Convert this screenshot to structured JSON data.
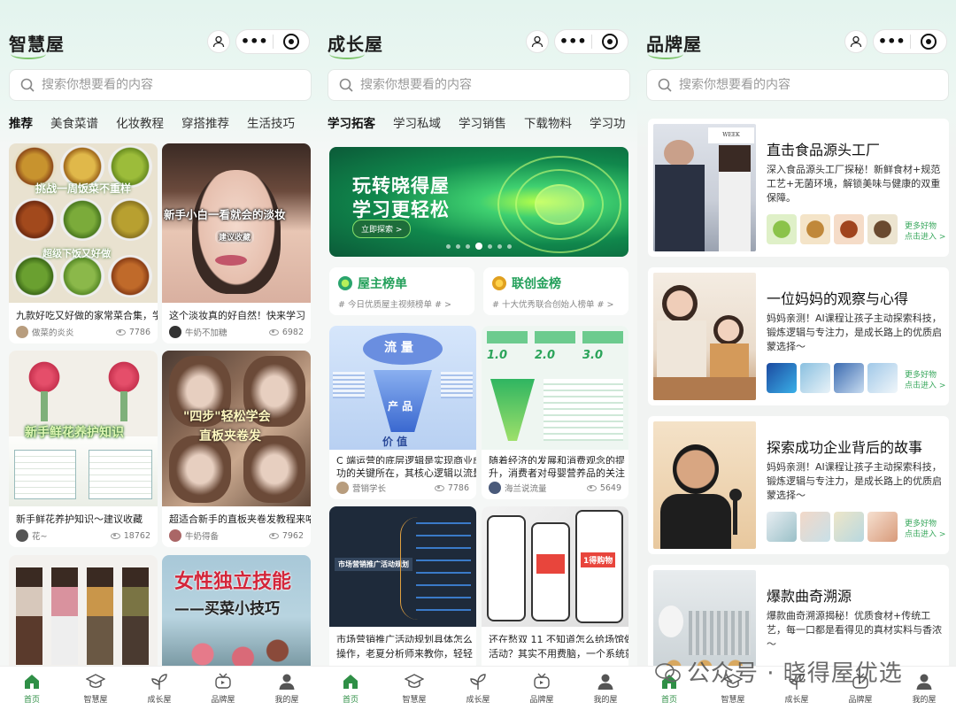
{
  "screens": [
    {
      "title": "智慧屋",
      "search_placeholder": "搜索你想要看的内容",
      "tabs": [
        "推荐",
        "美食菜谱",
        "化妆教程",
        "穿搭推荐",
        "生活技巧"
      ],
      "cards": [
        {
          "title": "九款好吃又好做的家常菜合集，学",
          "author": "做菜的炎炎",
          "views": "7786",
          "overlay": "挑战一周饭菜不重样",
          "overlay2": "超级下饭又好做"
        },
        {
          "title": "这个淡妆真的好自然！快来学习",
          "author": "牛奶不加糖",
          "views": "6982",
          "overlay": "新手小白一看就会的淡妆",
          "overlay2": "建议收藏"
        },
        {
          "title": "新手鲜花养护知识～建议收藏",
          "author": "花~",
          "views": "18762",
          "overlay": "新手鲜花养护知识"
        },
        {
          "title": "超适合新手的直板夹卷发教程来咯",
          "author": "牛奶得备",
          "views": "7962",
          "overlay": "\"四步\"轻松学会",
          "overlay2": "直板夹卷发"
        },
        {
          "title": "",
          "author": "",
          "views": ""
        },
        {
          "title": "",
          "author": "",
          "views": "",
          "overlay": "女性独立技能",
          "overlay2": "——买菜小技巧"
        }
      ]
    },
    {
      "title": "成长屋",
      "search_placeholder": "搜索你想要看的内容",
      "tabs": [
        "学习拓客",
        "学习私域",
        "学习销售",
        "下载物料",
        "学习功"
      ],
      "banner": {
        "line1": "玩转晓得屋",
        "line2": "学习更轻松",
        "button": "立即探索 >"
      },
      "ranks": [
        {
          "title": "屋主榜单",
          "sub": "# 今日优质屋主视频榜单 #    >"
        },
        {
          "title": "联创金榜",
          "sub": "# 十大优秀联合创始人榜单 #    >"
        }
      ],
      "cards": [
        {
          "title": "C 端运营的底层逻辑是实现商业成",
          "title2": "功的关键所在，其核心逻辑以流量",
          "author": "营销学长",
          "views": "7786",
          "overlay": "流 量",
          "overlay2": "产 品",
          "overlay3": "价 值"
        },
        {
          "title": "随着经济的发展和消费观念的提",
          "title2": "升，消费者对母婴营养品的关注",
          "author": "海兰说流量",
          "views": "5649",
          "steps": [
            "1.0",
            "2.0",
            "3.0"
          ]
        },
        {
          "title": "市场营销推广活动规划具体怎么",
          "title2": "操作，老夏分析师来教你，轻轻",
          "author": "",
          "views": "",
          "overlay": "市场营销推广活动规划"
        },
        {
          "title": "还在愁双 11 不知道怎么给场馆做",
          "title2": "活动？其实不用费脑，一个系统就",
          "author": "",
          "views": "",
          "overlay": "1得购物"
        }
      ]
    },
    {
      "title": "品牌屋",
      "search_placeholder": "搜索你想要看的内容",
      "brands": [
        {
          "title": "直击食品源头工厂",
          "desc": "深入食品源头工厂探秘！新鲜食材+规范工艺+无菌环境，解锁美味与健康的双重保障。",
          "more": "更多好物",
          "more2": "点击进入 >"
        },
        {
          "title": "一位妈妈的观察与心得",
          "desc": "妈妈亲测！AI课程让孩子主动探索科技，锻炼逻辑与专注力，是成长路上的优质启蒙选择～",
          "more": "更多好物",
          "more2": "点击进入 >"
        },
        {
          "title": "探索成功企业背后的故事",
          "desc": "妈妈亲测！AI课程让孩子主动探索科技，锻炼逻辑与专注力，是成长路上的优质启蒙选择～",
          "more": "更多好物",
          "more2": "点击进入 >"
        },
        {
          "title": "爆款曲奇溯源",
          "desc": "爆款曲奇溯源揭秘！优质食材+传统工艺，每一口都是看得见的真材实料与香浓～",
          "more": "",
          "more2": ""
        }
      ]
    }
  ],
  "tabbar": [
    "首页",
    "智慧屋",
    "成长屋",
    "品牌屋",
    "我的屋"
  ],
  "watermark": "公众号 · 晓得屋优选",
  "colors": {
    "accent": "#2f8f46",
    "tab_underline": "#a8dc4a",
    "rank_green": "#23a05a"
  }
}
